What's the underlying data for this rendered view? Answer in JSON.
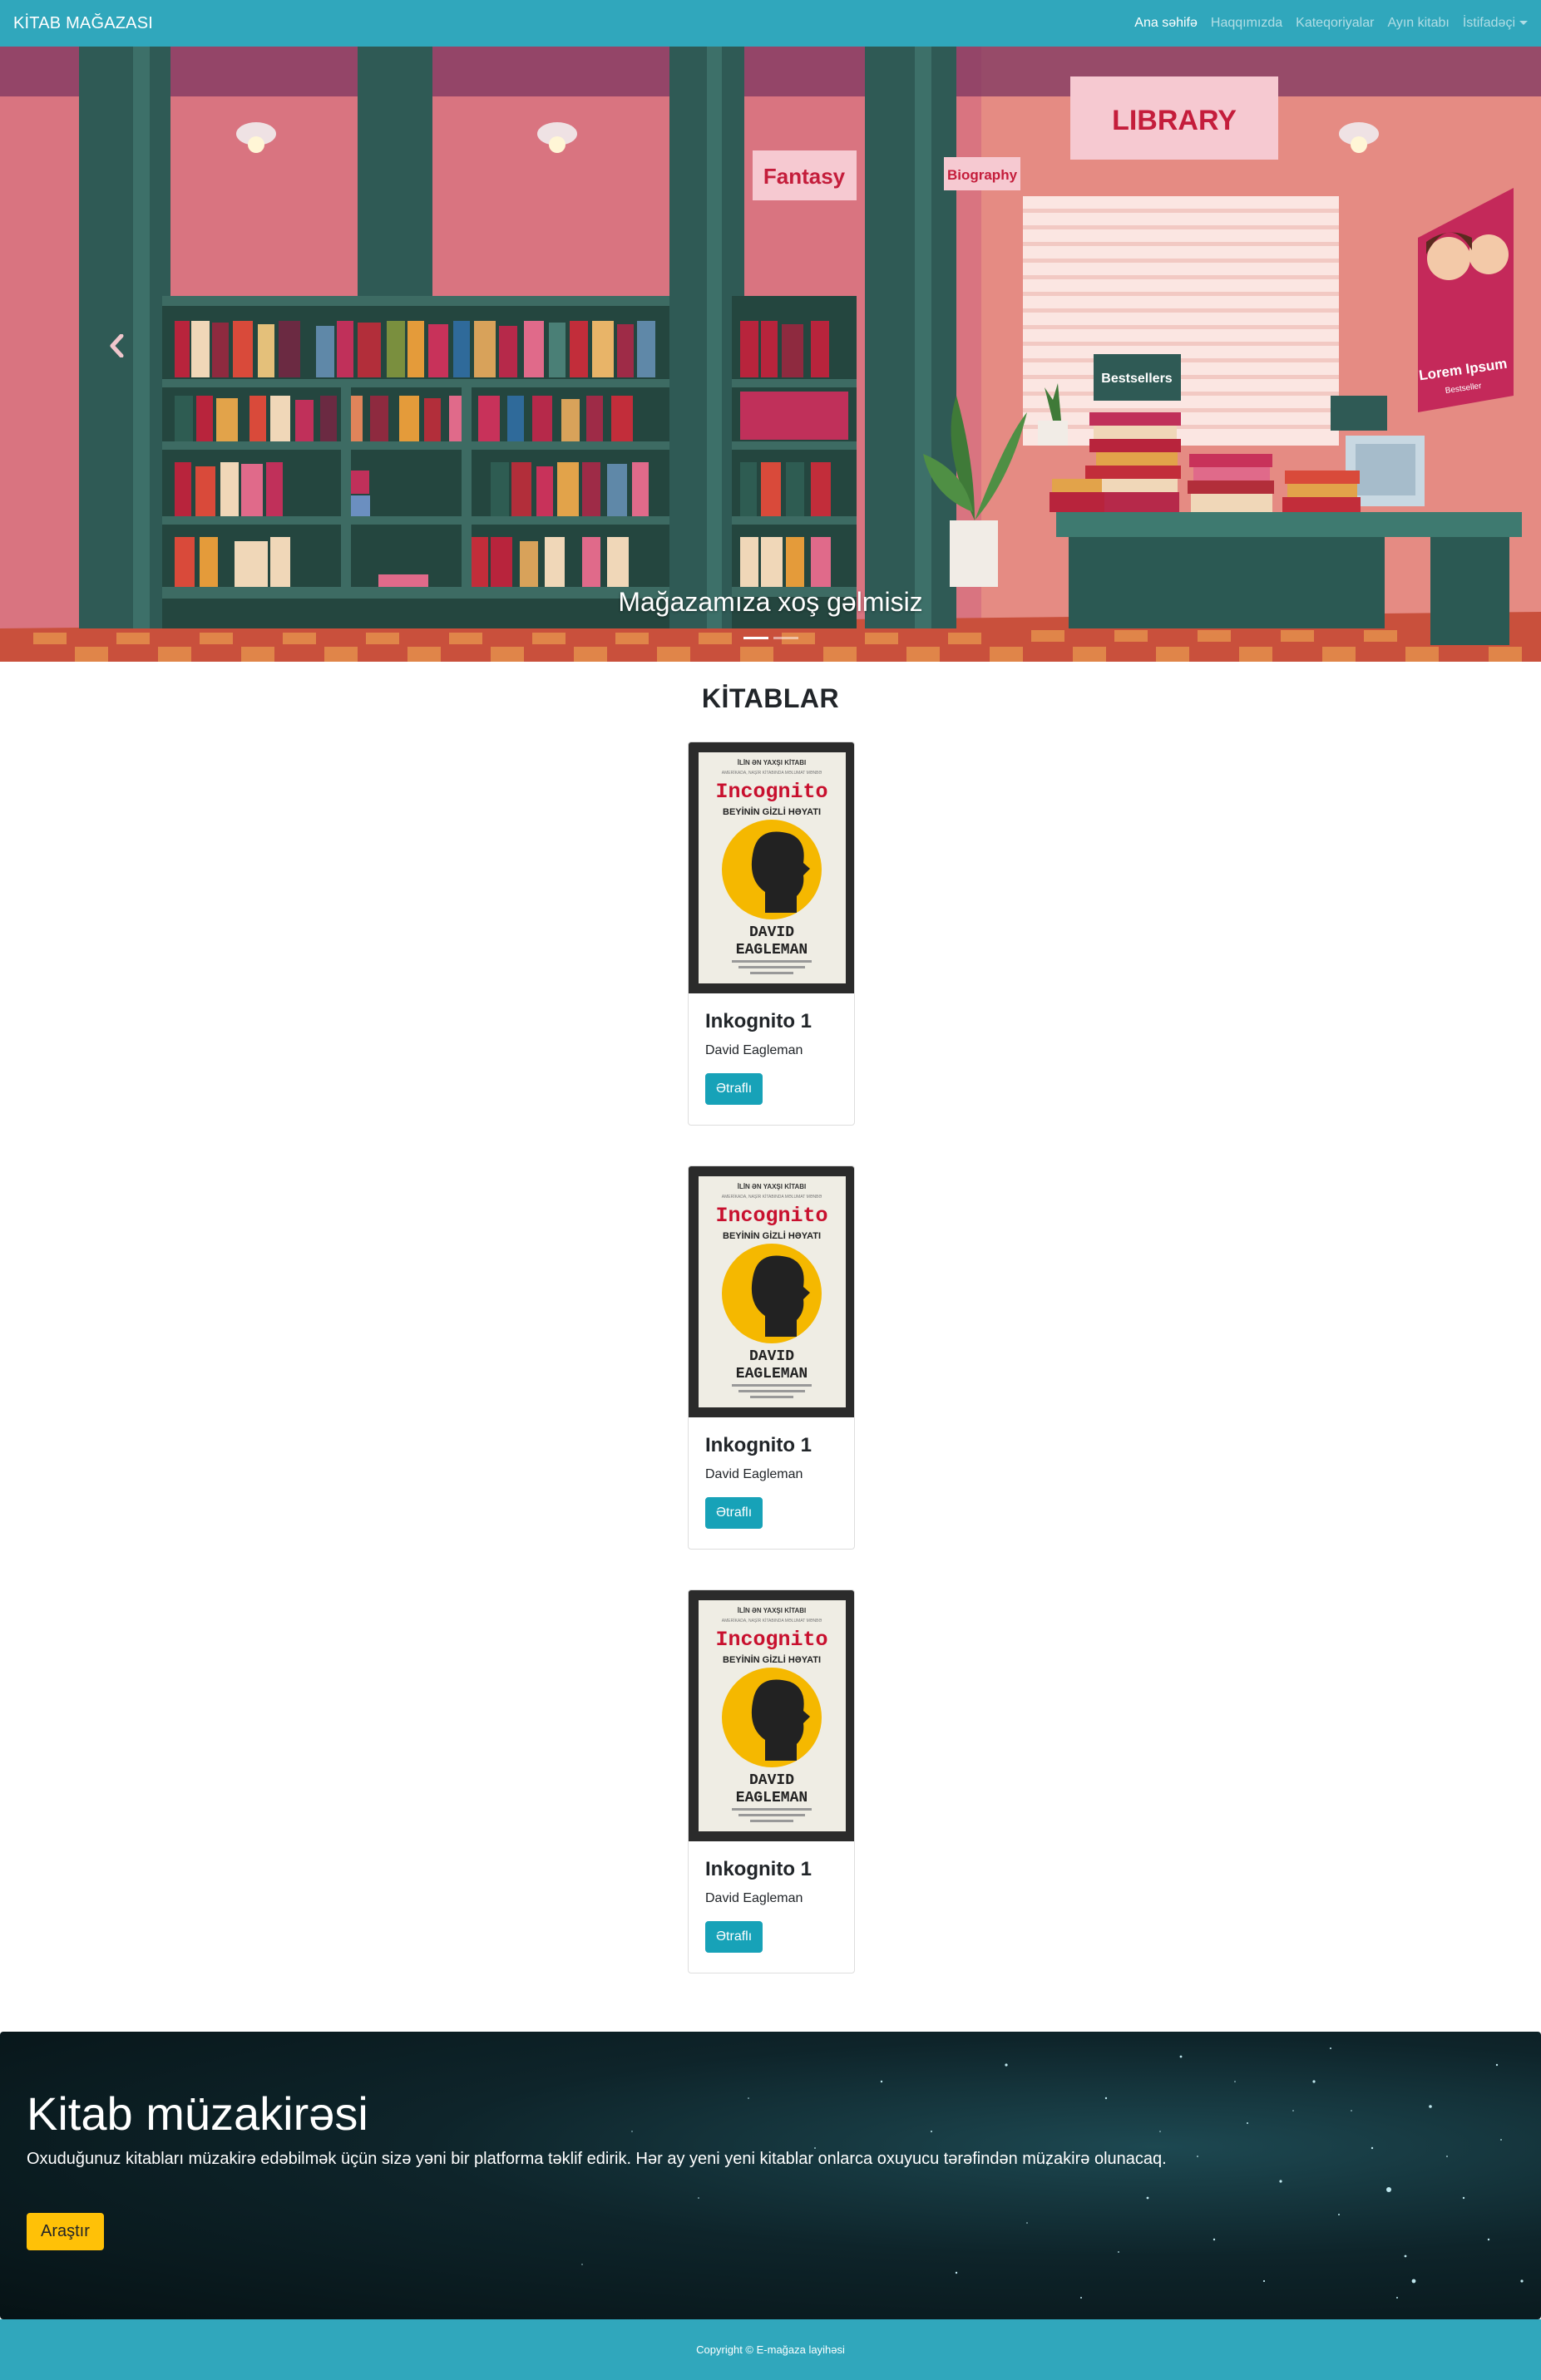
{
  "navbar": {
    "brand": "KİTAB MAĞAZASI",
    "links": [
      "Ana səhifə",
      "Haqqımızda",
      "Kateqoriyalar",
      "Ayın kitabı",
      "İstifadəçi"
    ]
  },
  "carousel": {
    "caption": "Mağazamıza xoş gəlmisiz",
    "signs": {
      "library": "LIBRARY",
      "fantasy": "Fantasy",
      "biography": "Biography",
      "bestsellers": "Bestsellers",
      "poster_title": "Lorem Ipsum",
      "poster_sub": "Bestseller"
    },
    "indicators": 2,
    "active_indicator": 0,
    "prev_icon": "chevron-left-icon",
    "next_icon": "chevron-right-icon"
  },
  "books": {
    "title": "KİTABLAR",
    "cover": {
      "top_line": "İLİN ƏN YAXŞI KİTABI",
      "sub_line": "AMERİKADA, NAŞİR KİTABINDA MƏLUMAT MƏNBƏ",
      "title": "Incognito",
      "subtitle": "BEYİNİN GİZLİ HƏYATI",
      "author_line1": "DAVID",
      "author_line2": "EAGLEMAN"
    },
    "items": [
      {
        "title": "Inkognito 1",
        "author": "David Eagleman",
        "button": "Ətraflı"
      },
      {
        "title": "Inkognito 1",
        "author": "David Eagleman",
        "button": "Ətraflı"
      },
      {
        "title": "Inkognito 1",
        "author": "David Eagleman",
        "button": "Ətraflı"
      }
    ]
  },
  "jumbotron": {
    "title": "Kitab müzakirəsi",
    "text": "Oxuduğunuz kitabları müzakirə edəbilmək üçün sizə yəni bir platforma təklif edirik. Hər ay yeni yeni kitablar onlarca oxuyucu tərəfindən müzakirə olunacaq.",
    "button": "Araştır"
  },
  "footer": {
    "copyright": "Copyright © E-mağaza layihəsi"
  },
  "colors": {
    "primary": "#30a7bc",
    "info_button": "#17a2b8",
    "warning_button": "#ffc107",
    "cover_accent": "#f5b800",
    "cover_title": "#c8102e"
  }
}
